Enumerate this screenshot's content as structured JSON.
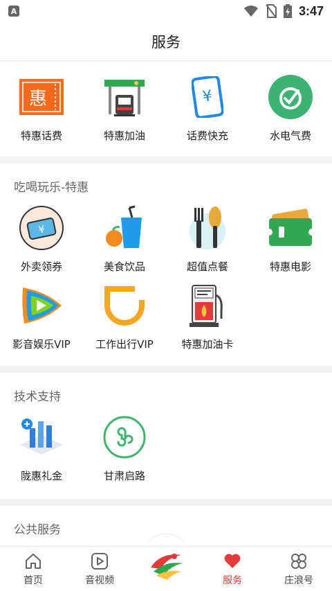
{
  "status": {
    "notification_letter": "A",
    "time": "3:47",
    "icons": [
      "wifi-icon",
      "no-sim-icon",
      "battery-charging-icon"
    ]
  },
  "header": {
    "title": "服务"
  },
  "services": {
    "items": [
      {
        "label": "特惠话费",
        "icon": "discount-ticket-icon",
        "glyph": "惠"
      },
      {
        "label": "特惠加油",
        "icon": "gas-station-icon"
      },
      {
        "label": "话费快充",
        "icon": "phone-yen-icon",
        "glyph": "¥"
      },
      {
        "label": "水电气费",
        "icon": "utility-leaf-icon"
      }
    ]
  },
  "fun": {
    "title": "吃喝玩乐-特惠",
    "items": [
      {
        "label": "外卖领券",
        "icon": "takeout-coupon-icon",
        "glyph": "¥"
      },
      {
        "label": "美食饮品",
        "icon": "drink-fruit-icon"
      },
      {
        "label": "超值点餐",
        "icon": "cutlery-icon"
      },
      {
        "label": "特惠电影",
        "icon": "movie-ticket-icon"
      },
      {
        "label": "影音娱乐VIP",
        "icon": "video-play-icon"
      },
      {
        "label": "工作出行VIP",
        "icon": "ride-hailing-icon"
      },
      {
        "label": "特惠加油卡",
        "icon": "fuel-card-icon"
      }
    ]
  },
  "tech": {
    "title": "技术支持",
    "items": [
      {
        "label": "陇惠礼金",
        "icon": "bar-chart-gift-icon"
      },
      {
        "label": "甘肃启路",
        "icon": "mini-program-icon"
      }
    ]
  },
  "public": {
    "title": "公共服务"
  },
  "tabbar": {
    "tabs": [
      {
        "label": "首页",
        "icon": "home-icon"
      },
      {
        "label": "音视频",
        "icon": "video-icon"
      },
      {
        "label": "",
        "icon": "app-logo-icon"
      },
      {
        "label": "服务",
        "icon": "heart-icon",
        "active": true
      },
      {
        "label": "庄浪号",
        "icon": "four-petal-icon"
      }
    ]
  },
  "colors": {
    "accent": "#e23b3b",
    "orange": "#f26b1d",
    "blue": "#1e88e5",
    "green": "#3cb371"
  }
}
